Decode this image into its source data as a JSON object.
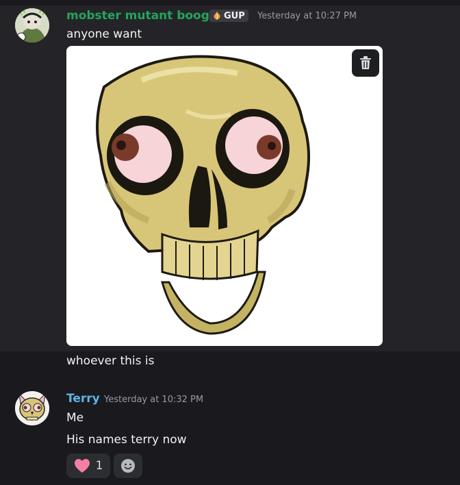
{
  "messages": [
    {
      "author": "mobster mutant booger",
      "author_color": "#23a55a",
      "badge": {
        "label": "GUP",
        "icon": "onion-icon"
      },
      "timestamp": "Yesterday at 10:27 PM",
      "text": "anyone want",
      "attachment": {
        "type": "image",
        "subject": "skull-drawing"
      },
      "followup_text": "whoever this is"
    },
    {
      "author": "Terry",
      "author_color": "#5eb3e4",
      "timestamp": "Yesterday at 10:32 PM",
      "lines": [
        "Me",
        "His names terry now"
      ],
      "reactions": [
        {
          "emoji": "heart-icon",
          "count": "1",
          "color": "#f47fa4"
        },
        {
          "emoji": "add-reaction-icon"
        }
      ]
    }
  ],
  "actions": {
    "delete_icon": "trash-icon"
  }
}
